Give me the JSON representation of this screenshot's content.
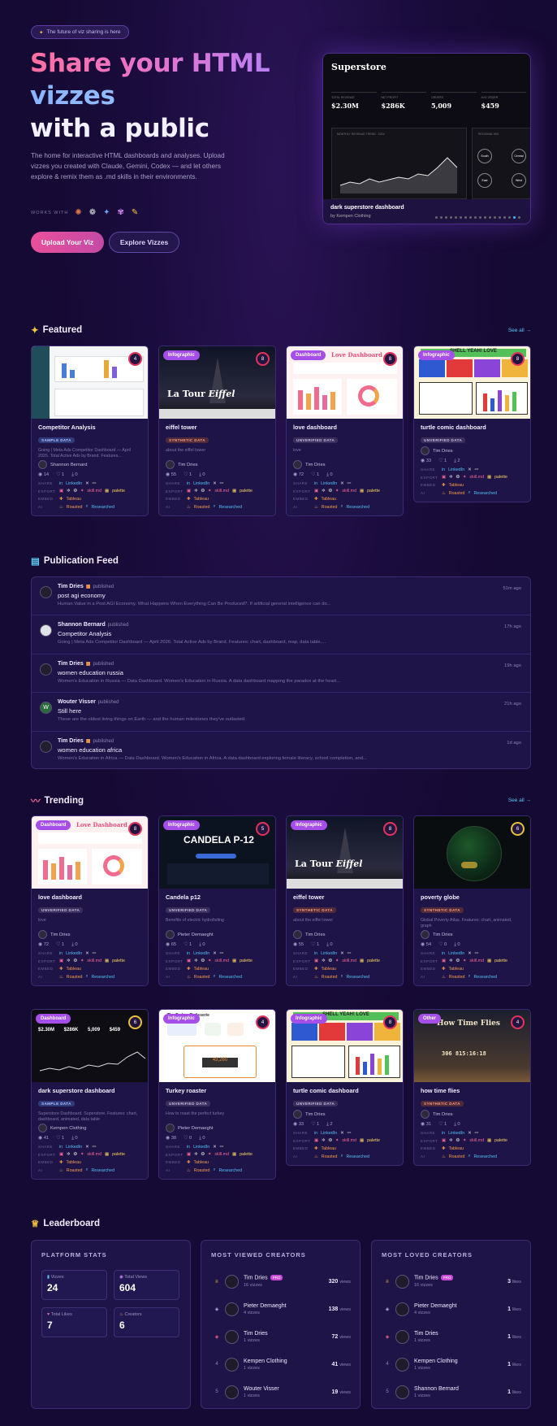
{
  "hero": {
    "pill": "The future of viz sharing is here",
    "line1": "Share your HTML",
    "line2": "vizzes",
    "line3": "with a public",
    "description": "The home for interactive HTML dashboards and analyses. Upload vizzes you created with Claude, Gemini, Codex — and let others explore & remix them as .md skills in their environments.",
    "works_with": "WORKS WITH",
    "upload_btn": "Upload Your Viz",
    "explore_btn": "Explore Vizzes",
    "card": {
      "brand": "Superstore",
      "k1l": "TOTAL REVENUE",
      "k1v": "$2.30M",
      "k2l": "NET PROFIT",
      "k2v": "$286K",
      "k3l": "ORDERS",
      "k3v": "5,009",
      "k4l": "AVG ORDER",
      "k4v": "$459",
      "chart_label": "MONTHLY REVENUE TREND · 2014",
      "side_label": "REGIONAL MIX",
      "r1": "South",
      "r2": "Central",
      "r3": "East",
      "r4": "West",
      "title": "dark superstore dashboard",
      "by": "by Kempen Clothing"
    }
  },
  "featured": {
    "title": "Featured",
    "see_all": "See all →",
    "cards": [
      {
        "title": "Competitor Analysis",
        "badge": "SAMPLE DATA",
        "desc": "Going | Meta Ads Competitor Dashboard — April 2026. Total Active Ads by Brand. Features...",
        "author": "Shannon Bernard",
        "views": "14",
        "likes": "1",
        "dl": "0",
        "tag": "",
        "ring": "4"
      },
      {
        "title": "eiffel tower",
        "badge": "SYNTHETIC DATA",
        "desc": "about the eiffel tower",
        "author": "Tim Dries",
        "views": "55",
        "likes": "1",
        "dl": "0",
        "tag": "Infographic",
        "ring": "8"
      },
      {
        "title": "love dashboard",
        "badge": "UNVERIFIED DATA",
        "desc": "love",
        "author": "Tim Dries",
        "views": "72",
        "likes": "1",
        "dl": "0",
        "tag": "Dashboard",
        "ring": "8"
      },
      {
        "title": "turtle comic dashboard",
        "badge": "UNVERIFIED DATA",
        "desc": "",
        "author": "Tim Dries",
        "views": "33",
        "likes": "1",
        "dl": "2",
        "tag": "Infographic",
        "ring": "8"
      }
    ]
  },
  "labels": {
    "share": "SHARE",
    "export": "EXPORT",
    "embed": "EMBED",
    "ai": "AI",
    "linkedin": "LinkedIn",
    "skill": "skill.md",
    "palette": "palette",
    "tableau": "Tableau",
    "roasted": "Roasted",
    "researched": "Researched",
    "published": "published"
  },
  "feed": {
    "title": "Publication Feed",
    "items": [
      {
        "name": "Tim Dries",
        "title": "post agi economy",
        "desc": "Human Value in a Post AGI Economy. What Happens When Everything Can Be Produced?. If artificial general intelligence can do...",
        "time": "51m ago"
      },
      {
        "name": "Shannon Bernard",
        "title": "Competitor Analysis",
        "desc": "Going | Meta Ads Competitor Dashboard — April 2026. Total Active Ads by Brand. Features: chart, dashboard, map, data table,...",
        "time": "17h ago"
      },
      {
        "name": "Tim Dries",
        "title": "women education russia",
        "desc": "Women's Education in Russia — Data Dashboard. Women's Education in Russia. A data dashboard mapping the paradox at the heart...",
        "time": "19h ago"
      },
      {
        "name": "Wouter Visser",
        "title": "Still here",
        "desc": "These are the oldest living things on Earth — and the human milestones they've outlasted.",
        "time": "21h ago"
      },
      {
        "name": "Tim Dries",
        "title": "women education africa",
        "desc": "Women's Education in Africa — Data Dashboard. Women's Education in Africa. A data dashboard exploring female literacy, school completion, and...",
        "time": "1d ago"
      }
    ]
  },
  "trending": {
    "title": "Trending",
    "see_all": "See all →",
    "cards": [
      {
        "title": "love dashboard",
        "badge": "UNVERIFIED DATA",
        "desc": "love",
        "author": "Tim Dries",
        "views": "72",
        "likes": "1",
        "dl": "0",
        "tag": "Dashboard",
        "ring": "8"
      },
      {
        "title": "Candela p12",
        "badge": "UNVERIFIED DATA",
        "desc": "Benefits of electric hydrofoiling",
        "author": "Pieter Demaeght",
        "views": "65",
        "likes": "1",
        "dl": "0",
        "tag": "Infographic",
        "ring": "5"
      },
      {
        "title": "eiffel tower",
        "badge": "SYNTHETIC DATA",
        "desc": "about the eiffel tower",
        "author": "Tim Dries",
        "views": "55",
        "likes": "1",
        "dl": "0",
        "tag": "Infographic",
        "ring": "8"
      },
      {
        "title": "poverty globe",
        "badge": "SYNTHETIC DATA",
        "desc": "Global Poverty Atlas. Features: chart, animated, graph",
        "author": "Tim Dries",
        "views": "54",
        "likes": "0",
        "dl": "0",
        "tag": "",
        "ring": "6"
      },
      {
        "title": "dark superstore dashboard",
        "badge": "SAMPLE DATA",
        "desc": "Superstore Dashboard. Superstore. Features: chart, dashboard, animated, data table",
        "author": "Kempen Clothing",
        "views": "41",
        "likes": "1",
        "dl": "0",
        "tag": "Dashboard",
        "ring": "6"
      },
      {
        "title": "Turkey roaster",
        "badge": "UNVERIFIED DATA",
        "desc": "How to roast the perfect turkey",
        "author": "Pieter Demaeght",
        "views": "38",
        "likes": "0",
        "dl": "0",
        "tag": "Infographic",
        "ring": "4"
      },
      {
        "title": "turtle comic dashboard",
        "badge": "UNVERIFIED DATA",
        "desc": "",
        "author": "Tim Dries",
        "views": "33",
        "likes": "1",
        "dl": "2",
        "tag": "Infographic",
        "ring": "8"
      },
      {
        "title": "how time flies",
        "badge": "SYNTHETIC DATA",
        "desc": "",
        "author": "Tim Dries",
        "views": "31",
        "likes": "1",
        "dl": "0",
        "tag": "Other",
        "ring": "4"
      }
    ]
  },
  "leaderboard": {
    "title": "Leaderboard",
    "platform": {
      "title": "PLATFORM STATS",
      "vizzes_l": "Vizzes",
      "vizzes": "24",
      "views_l": "Total Views",
      "views": "604",
      "likes_l": "Total Likes",
      "likes": "7",
      "creators_l": "Creators",
      "creators": "6"
    },
    "viewed": {
      "title": "MOST VIEWED CREATORS",
      "rows": [
        {
          "rank": "1",
          "name": "Tim Dries",
          "sub": "16 vizzes",
          "val": "320",
          "unit": "views",
          "pro": "PRO"
        },
        {
          "rank": "2",
          "name": "Pieter Demaeght",
          "sub": "4 vizzes",
          "val": "138",
          "unit": "views"
        },
        {
          "rank": "3",
          "name": "Tim Dries",
          "sub": "1 vizzes",
          "val": "72",
          "unit": "views"
        },
        {
          "rank": "4",
          "name": "Kempen Clothing",
          "sub": "1 vizzes",
          "val": "41",
          "unit": "views"
        },
        {
          "rank": "5",
          "name": "Wouter Visser",
          "sub": "1 vizzes",
          "val": "19",
          "unit": "views"
        }
      ]
    },
    "loved": {
      "title": "MOST LOVED CREATORS",
      "rows": [
        {
          "rank": "1",
          "name": "Tim Dries",
          "sub": "16 vizzes",
          "val": "3",
          "unit": "likes",
          "pro": "PRO"
        },
        {
          "rank": "2",
          "name": "Pieter Demaeght",
          "sub": "4 vizzes",
          "val": "1",
          "unit": "likes"
        },
        {
          "rank": "3",
          "name": "Tim Dries",
          "sub": "1 vizzes",
          "val": "1",
          "unit": "likes"
        },
        {
          "rank": "4",
          "name": "Kempen Clothing",
          "sub": "1 vizzes",
          "val": "1",
          "unit": "likes"
        },
        {
          "rank": "5",
          "name": "Shannon Bernard",
          "sub": "1 vizzes",
          "val": "1",
          "unit": "likes"
        }
      ]
    }
  }
}
